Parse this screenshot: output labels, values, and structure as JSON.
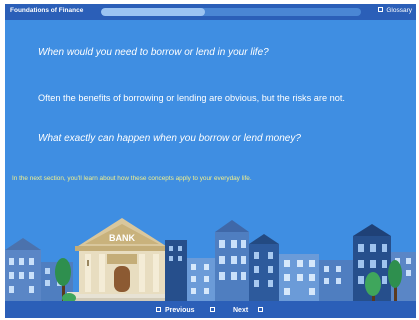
{
  "header": {
    "course_title": "Foundations of Finance",
    "progress": 0.4,
    "glossary_label": "Glossary"
  },
  "content": {
    "question_1": "When would you need to borrow or lend in your life?",
    "statement": "Often the benefits of borrowing or lending are obvious, but the risks are not.",
    "question_2": "What exactly can happen when you borrow or lend money?",
    "note": "In the next section, you'll learn about how these concepts apply to your everyday life."
  },
  "scene": {
    "bank_sign": "BANK"
  },
  "footer": {
    "previous_label": "Previous",
    "next_label": "Next"
  },
  "colors": {
    "background": "#3f8ee2",
    "bar": "#2b5fb8",
    "note_text": "#f3f08a"
  }
}
